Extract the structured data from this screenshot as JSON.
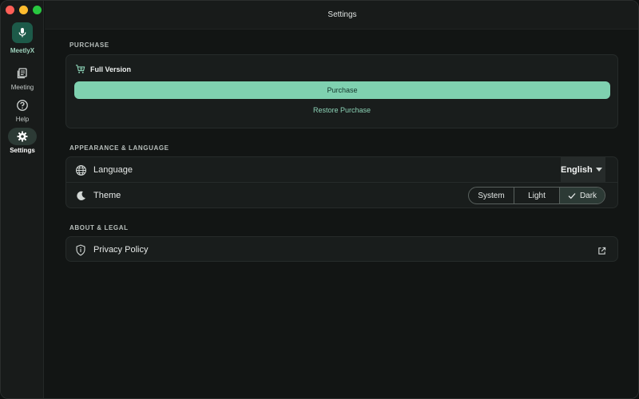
{
  "window": {
    "title": "Settings"
  },
  "sidebar": {
    "brand": {
      "name": "MeetlyX",
      "icon": "microphone-icon"
    },
    "items": [
      {
        "label": "Meeting",
        "icon": "document-stack-icon",
        "active": false
      },
      {
        "label": "Help",
        "icon": "question-circle-icon",
        "active": false
      },
      {
        "label": "Settings",
        "icon": "gear-icon",
        "active": true
      }
    ]
  },
  "sections": {
    "purchase": {
      "title": "PURCHASE",
      "product": "Full Version",
      "product_icon": "cart-icon",
      "purchase_label": "Purchase",
      "restore_label": "Restore Purchase"
    },
    "appearance": {
      "title": "APPEARANCE & LANGUAGE",
      "language_label": "Language",
      "language_value": "English",
      "theme_label": "Theme",
      "theme_options": [
        "System",
        "Light",
        "Dark"
      ],
      "theme_selected": "Dark"
    },
    "about": {
      "title": "ABOUT & LEGAL",
      "privacy_label": "Privacy Policy"
    }
  },
  "colors": {
    "accent": "#7fd1b0",
    "accent_text": "#8dd4b7",
    "brand_bg": "#1d5a49",
    "active_nav_bg": "#2c3a35"
  }
}
